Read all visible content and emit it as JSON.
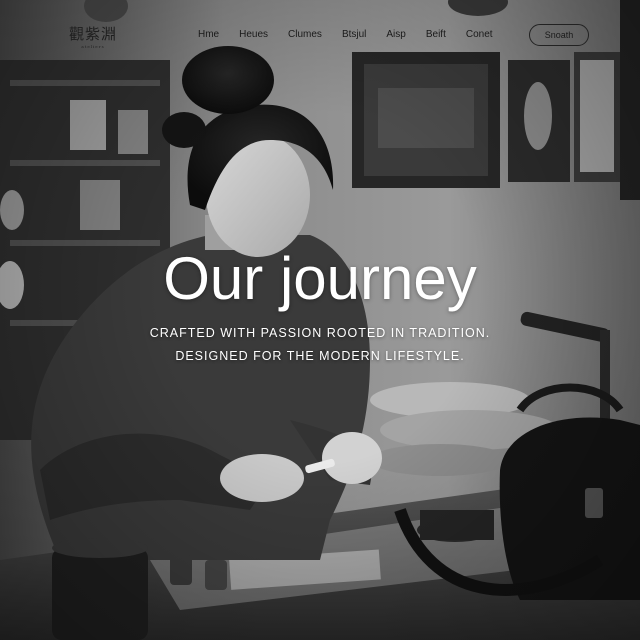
{
  "brand": {
    "logo_text": "觀紫淵",
    "logo_subtext": "ateliers"
  },
  "nav": {
    "items": [
      {
        "label": "Hme"
      },
      {
        "label": "Heues"
      },
      {
        "label": "Clumes"
      },
      {
        "label": "Btsjul"
      },
      {
        "label": "Aisp"
      },
      {
        "label": "Beift"
      },
      {
        "label": "Conet"
      }
    ],
    "search_label": "Snoath"
  },
  "hero": {
    "headline": "Our journey",
    "tagline_line1": "CRAFTED WITH PASSION ROOTED IN TRADITION.",
    "tagline_line2": "DESIGNED FOR THE MODERN LIFESTYLE."
  },
  "colors": {
    "overlay_text": "#ffffff",
    "nav_text": "#1a1a1a",
    "photo_tone": "grayscale"
  }
}
